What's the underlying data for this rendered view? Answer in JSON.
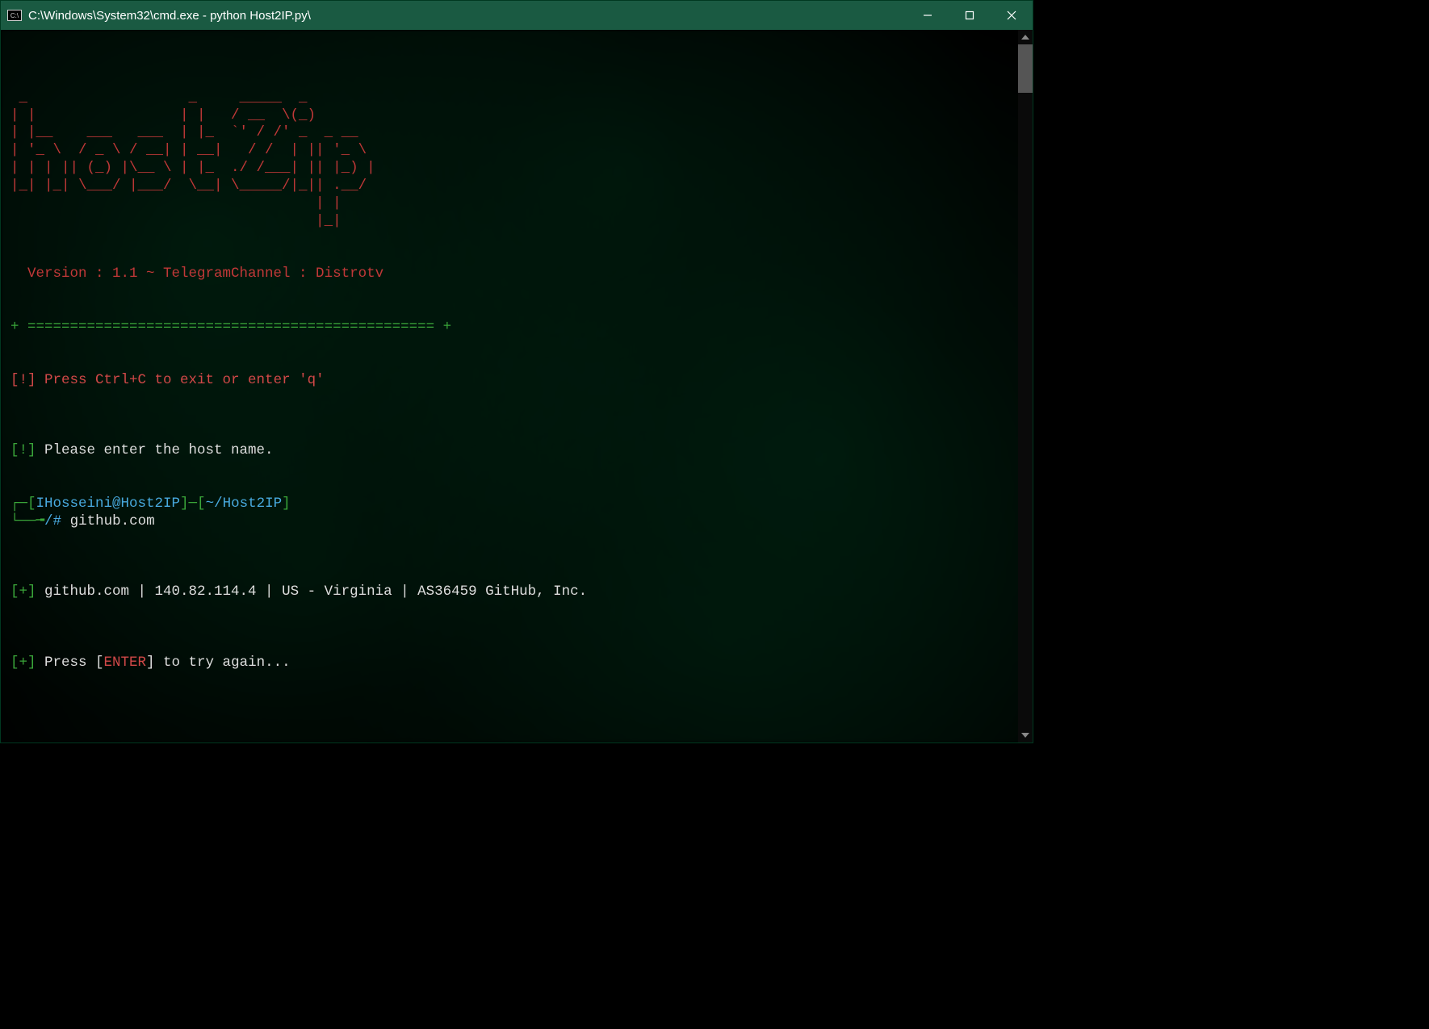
{
  "titlebar": {
    "title": "C:\\Windows\\System32\\cmd.exe - python  Host2IP.py\\"
  },
  "ascii_art": " _                   _     _____  _\n| |                 | |   / __  \\(_)\n| |__    ___   ___  | |_  `' / /' _  _ __\n| '_ \\  / _ \\ / __| | __|   / /  | || '_ \\\n| | | || (_) |\\__ \\ | |_  ./ /___| || |_) |\n|_| |_| \\___/ |___/  \\__| \\_____/|_|| .__/\n                                    | |\n                                    |_|",
  "version_line": "  Version : 1.1 ~ TelegramChannel : Distrotv",
  "separator": "+ ================================================ +",
  "exit_note": {
    "prefix": "[!]",
    "text": " Press Ctrl+C to exit or enter 'q'"
  },
  "prompt_note": {
    "prefix": "[!]",
    "text": " Please enter the host name."
  },
  "shell_prompt": {
    "l1_open": "┌─[",
    "l1_userhost": "IHosseini@Host2IP",
    "l1_mid": "]─[",
    "l1_path": "~/Host2IP",
    "l1_close": "]",
    "l2_open": "└──╼",
    "l2_hash": "/#",
    "l2_input": " github.com"
  },
  "result": {
    "prefix": "[+]",
    "text": " github.com | 140.82.114.4 | US - Virginia | AS36459 GitHub, Inc."
  },
  "retry": {
    "prefix": "[+]",
    "text_before": " Press [",
    "enter": "ENTER",
    "text_after": "] to try again..."
  }
}
